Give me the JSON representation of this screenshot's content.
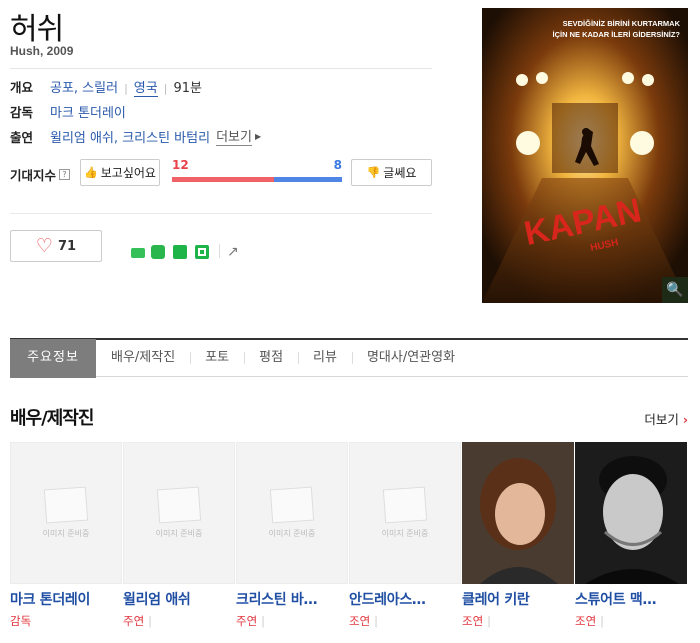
{
  "movie": {
    "title": "허쉬",
    "subtitle": "Hush, 2009"
  },
  "info": {
    "overview_label": "개요",
    "genres": "공포, 스릴러",
    "country": "영국",
    "runtime": "91분",
    "director_label": "감독",
    "director": "마크 톤더레이",
    "cast_label": "출연",
    "cast": "윌리엄 애쉬, 크리스틴 바텀리",
    "more": "더보기"
  },
  "expect": {
    "label": "기대지수",
    "help": "?",
    "want_label": "보고싶어요",
    "meh_label": "글쎄요",
    "want_count": "12",
    "meh_count": "8",
    "want_ratio": 0.6
  },
  "like": {
    "count": "71"
  },
  "tabs": [
    "주요정보",
    "배우/제작진",
    "포토",
    "평점",
    "리뷰",
    "명대사/연관영화"
  ],
  "cast_section": {
    "title": "배우/제작진",
    "more": "더보기",
    "placeholder": "이미지 준비중",
    "people": [
      {
        "name": "마크 톤더레이",
        "role": "감독"
      },
      {
        "name": "윌리엄 애쉬",
        "role": "주연"
      },
      {
        "name": "크리스틴 바…",
        "role": "주연"
      },
      {
        "name": "안드레아스…",
        "role": "조연"
      },
      {
        "name": "클레어 키란",
        "role": "조연"
      },
      {
        "name": "스튜어트 맥…",
        "role": "조연"
      }
    ]
  },
  "poster": {
    "tagline": "SEVDİĞİNİZ BİRİNİ KURTARMAK İÇİN NE KADAR İLERİ GİDERSİNİZ?",
    "title_text": "KAPAN",
    "sub_text": "HUSH"
  },
  "colors": {
    "want": "#f06168",
    "meh": "#4f86e6",
    "link": "#2a5aab",
    "accent_red": "#e0343c"
  }
}
